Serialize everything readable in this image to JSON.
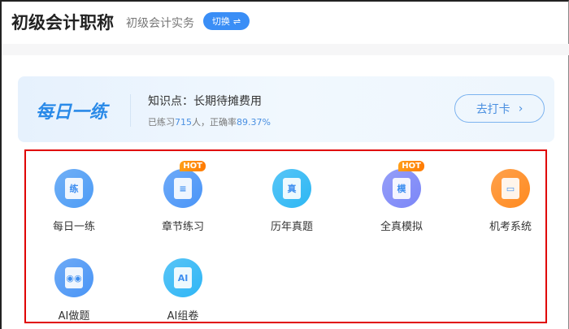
{
  "header": {
    "title": "初级会计职称",
    "subject": "初级会计实务",
    "switch_label": "切换",
    "switch_icon": "⇌"
  },
  "daily": {
    "brand": "每日一练",
    "knowledge_point": "知识点：长期待摊费用",
    "stats_prefix": "已练习",
    "count": "715",
    "stats_mid": "人，正确率",
    "accuracy": "89.37%",
    "button_label": "去打卡",
    "button_icon": "›"
  },
  "tools": [
    {
      "label": "每日一练",
      "glyph": "练",
      "hot": false,
      "color": "#4d9cf5"
    },
    {
      "label": "章节练习",
      "glyph": "≡",
      "hot": true,
      "hot_label": "HOT",
      "color": "#4a95f7"
    },
    {
      "label": "历年真题",
      "glyph": "真",
      "hot": false,
      "color": "#2db7f4"
    },
    {
      "label": "全真模拟",
      "glyph": "模",
      "hot": true,
      "hot_label": "HOT",
      "color": "#7b86f7"
    },
    {
      "label": "机考系统",
      "glyph": "▭",
      "hot": false,
      "color": "#ff8a1f"
    },
    {
      "label": "AI做题",
      "glyph": "◉◉",
      "hot": false,
      "color": "#4a95f5"
    },
    {
      "label": "AI组卷",
      "glyph": "AI",
      "hot": false,
      "color": "#2fb6f5"
    }
  ]
}
